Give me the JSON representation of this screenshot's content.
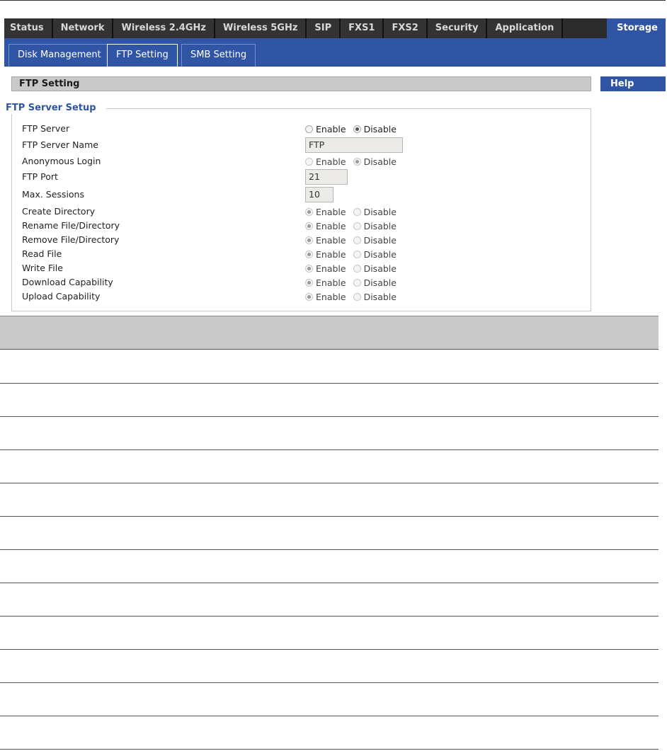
{
  "nav": {
    "main_tabs": [
      "Status",
      "Network",
      "Wireless 2.4GHz",
      "Wireless 5GHz",
      "SIP",
      "FXS1",
      "FXS2",
      "Security",
      "Application",
      "Storage"
    ],
    "active_main": "Storage",
    "sub_tabs": [
      "Disk Management",
      "FTP Setting",
      "SMB Setting"
    ],
    "active_sub": "FTP Setting"
  },
  "section": {
    "title": "FTP Setting",
    "help": "Help"
  },
  "ftp": {
    "legend": "FTP Server Setup",
    "fields": [
      {
        "label": "FTP Server",
        "type": "radio",
        "enable": "Enable",
        "disable": "Disable",
        "value": "Disable"
      },
      {
        "label": "FTP Server Name",
        "type": "text",
        "value": "FTP"
      },
      {
        "label": "Anonymous Login",
        "type": "radio",
        "enable": "Enable",
        "disable": "Disable",
        "value": "Disable"
      },
      {
        "label": "FTP Port",
        "type": "text",
        "value": "21"
      },
      {
        "label": "Max. Sessions",
        "type": "text",
        "value": "10"
      },
      {
        "label": "Create Directory",
        "type": "radio",
        "enable": "Enable",
        "disable": "Disable",
        "value": "Enable"
      },
      {
        "label": "Rename File/Directory",
        "type": "radio",
        "enable": "Enable",
        "disable": "Disable",
        "value": "Enable"
      },
      {
        "label": "Remove File/Directory",
        "type": "radio",
        "enable": "Enable",
        "disable": "Disable",
        "value": "Enable"
      },
      {
        "label": "Read File",
        "type": "radio",
        "enable": "Enable",
        "disable": "Disable",
        "value": "Enable"
      },
      {
        "label": "Write File",
        "type": "radio",
        "enable": "Enable",
        "disable": "Disable",
        "value": "Enable"
      },
      {
        "label": "Download Capability",
        "type": "radio",
        "enable": "Enable",
        "disable": "Disable",
        "value": "Enable"
      },
      {
        "label": "Upload Capability",
        "type": "radio",
        "enable": "Enable",
        "disable": "Disable",
        "value": "Enable"
      }
    ]
  },
  "colors": {
    "accent": "#2f55a4",
    "nav_dark": "#333333",
    "section_gray": "#c9c9c9"
  }
}
